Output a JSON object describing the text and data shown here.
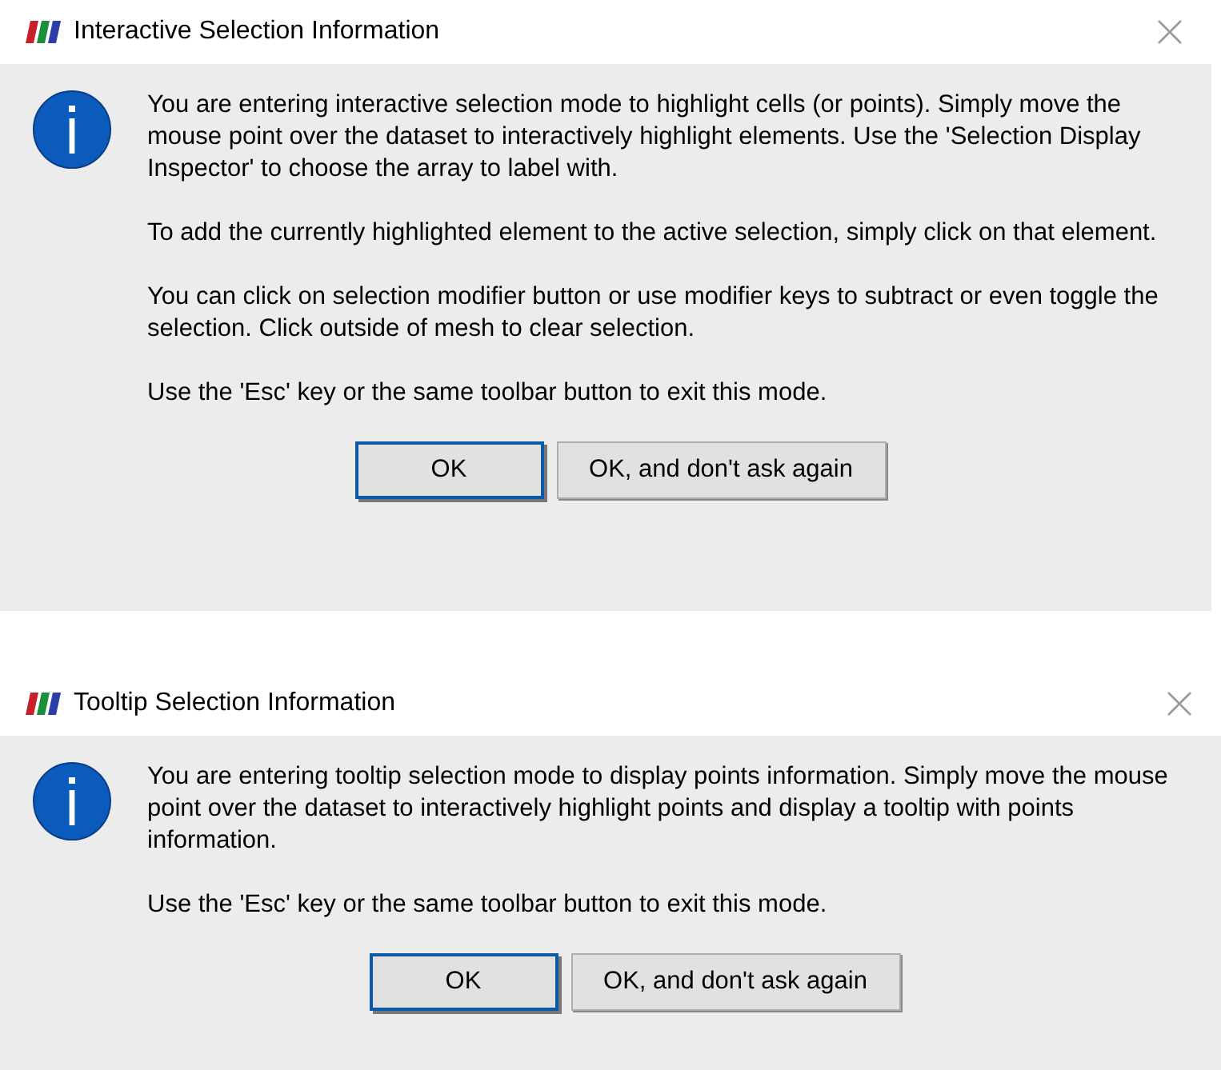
{
  "dialogs": [
    {
      "title": "Interactive Selection Information",
      "paragraphs": [
        "You are entering interactive selection mode to highlight cells (or points). Simply move the mouse point over the dataset to interactively highlight elements. Use the 'Selection Display Inspector' to choose the array to label with.",
        "To add the currently highlighted element to the active selection, simply click on that element.",
        "You can click on selection modifier button or use modifier keys to subtract or even toggle the selection. Click outside of mesh to clear selection.",
        "Use the 'Esc' key or the same toolbar button to exit this mode."
      ],
      "buttons": [
        {
          "label": "OK",
          "default": true
        },
        {
          "label": "OK, and don't ask again",
          "default": false
        }
      ]
    },
    {
      "title": "Tooltip Selection Information",
      "paragraphs": [
        "You are entering tooltip selection mode to display points information. Simply move the mouse point over the dataset to interactively highlight points and display a tooltip with points information.",
        "Use the 'Esc' key or the same toolbar button to exit this mode."
      ],
      "buttons": [
        {
          "label": "OK",
          "default": true
        },
        {
          "label": "OK, and don't ask again",
          "default": false
        }
      ]
    }
  ]
}
